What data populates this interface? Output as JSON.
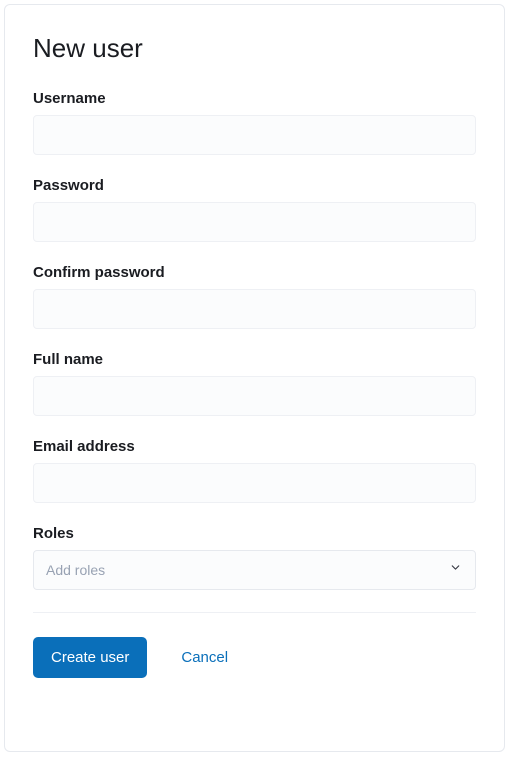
{
  "title": "New user",
  "fields": {
    "username": {
      "label": "Username",
      "value": ""
    },
    "password": {
      "label": "Password",
      "value": ""
    },
    "confirm_password": {
      "label": "Confirm password",
      "value": ""
    },
    "full_name": {
      "label": "Full name",
      "value": ""
    },
    "email": {
      "label": "Email address",
      "value": ""
    },
    "roles": {
      "label": "Roles",
      "placeholder": "Add roles"
    }
  },
  "actions": {
    "submit": "Create user",
    "cancel": "Cancel"
  }
}
